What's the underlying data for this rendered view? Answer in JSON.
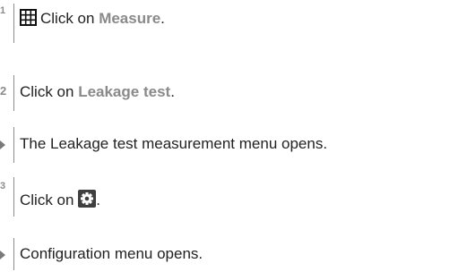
{
  "steps": [
    {
      "marker": "1",
      "icon": "grid-icon",
      "prefix": "Click on ",
      "highlight": "Measure",
      "suffix": "."
    },
    {
      "marker": "2",
      "prefix": "Click on ",
      "highlight": "Leakage test",
      "suffix": "."
    },
    {
      "marker": "result-arrow",
      "text": "The Leakage test measurement menu opens."
    },
    {
      "marker": "3",
      "prefix": "Click on ",
      "icon": "gear-icon",
      "suffix": "."
    },
    {
      "marker": "result-arrow",
      "text": "Configuration menu opens."
    }
  ],
  "colors": {
    "text": "#222222",
    "highlight": "#8a8a8a",
    "marker": "#8c8c8c",
    "icon_dark": "#111111"
  }
}
